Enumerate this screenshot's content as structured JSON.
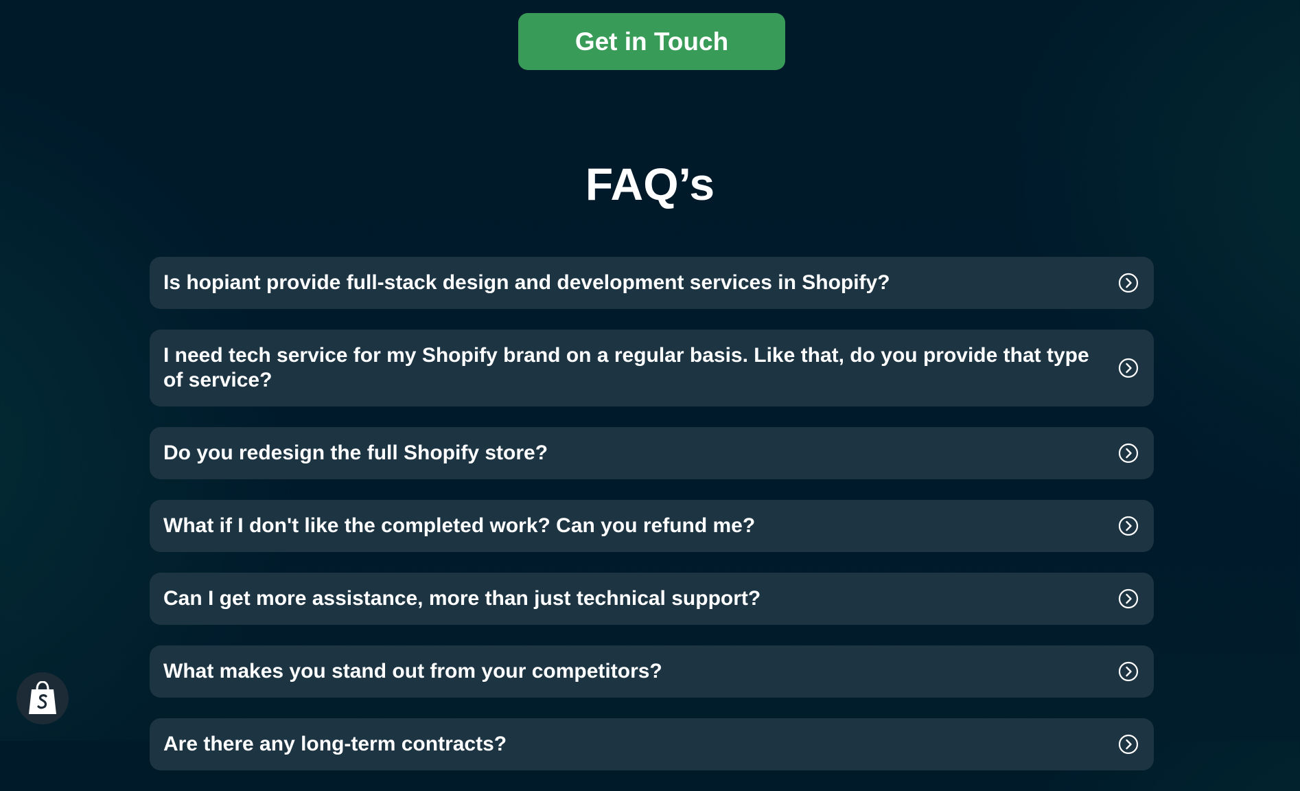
{
  "cta": {
    "label": "Get in Touch",
    "color": "#389c58"
  },
  "faq": {
    "title": "FAQ’s",
    "items": [
      {
        "question": "Is hopiant provide full-stack design and development services in Shopify?"
      },
      {
        "question": "I need tech service for my Shopify brand on a regular basis. Like that, do you provide that type of service?"
      },
      {
        "question": "Do you redesign the full Shopify store?"
      },
      {
        "question": "What if I don't like the completed work? Can you refund me?"
      },
      {
        "question": "Can I get more assistance, more than just technical support?"
      },
      {
        "question": "What makes you stand out from your competitors?"
      },
      {
        "question": "Are there any long-term contracts?"
      }
    ],
    "icon": "chevron-right-circle-icon"
  },
  "badge": {
    "icon": "shopify-bag-icon"
  }
}
